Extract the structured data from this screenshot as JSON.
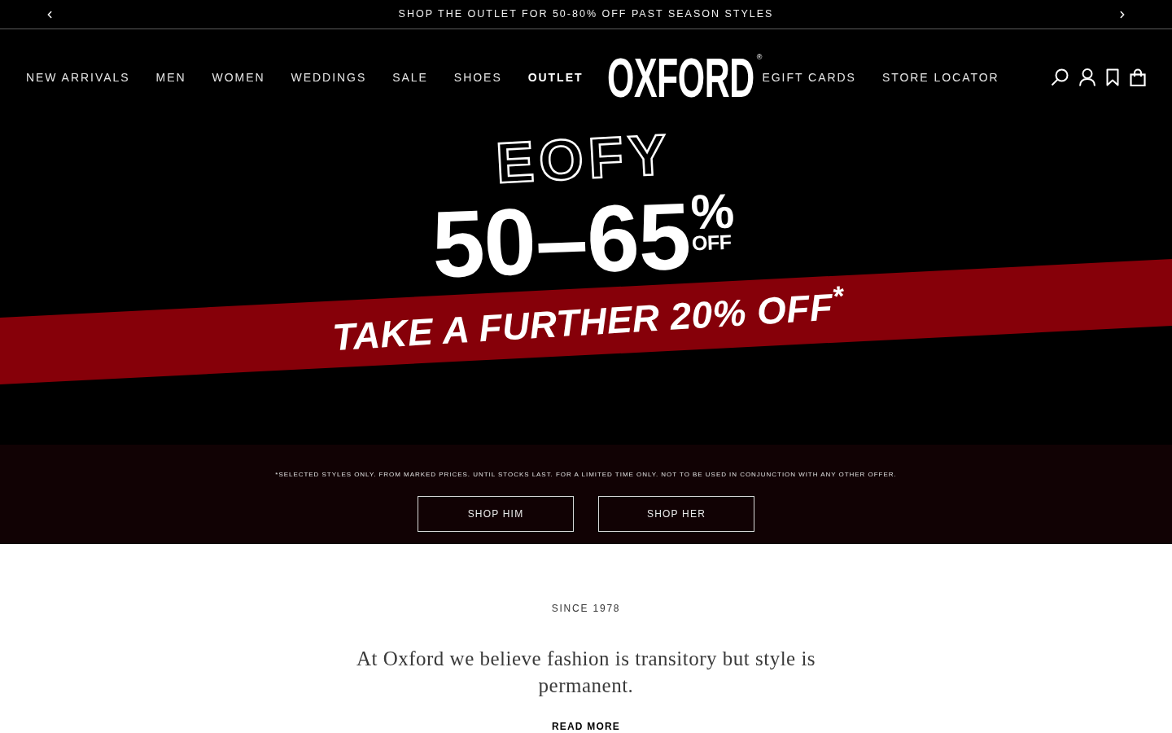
{
  "announcement_bar": {
    "message": "SHOP THE OUTLET FOR 50-80% OFF PAST SEASON STYLES"
  },
  "header": {
    "nav_left": [
      {
        "label": "NEW ARRIVALS",
        "emphasized": false
      },
      {
        "label": "MEN",
        "emphasized": false
      },
      {
        "label": "WOMEN",
        "emphasized": false
      },
      {
        "label": "WEDDINGS",
        "emphasized": false
      },
      {
        "label": "SALE",
        "emphasized": false
      },
      {
        "label": "SHOES",
        "emphasized": false
      },
      {
        "label": "OUTLET",
        "emphasized": true
      }
    ],
    "logo": {
      "text": "OXFORD",
      "mark": "®"
    },
    "nav_right": [
      {
        "label": "EGIFT CARDS",
        "emphasized": false
      },
      {
        "label": "STORE LOCATOR",
        "emphasized": false
      }
    ]
  },
  "hero": {
    "kicker": "EOFY",
    "discount": "50–65",
    "percent": "%",
    "off": "OFF",
    "band_text": "TAKE A FURTHER 20% OFF$^{*}$"
  },
  "promo": {
    "disclaimer": "*SELECTED STYLES ONLY. FROM MARKED PRICES. UNTIL STOCKS LAST. FOR A LIMITED TIME ONLY. NOT TO BE USED IN CONJUNCTION WITH ANY OTHER OFFER.",
    "buttons": [
      "SHOP HIM",
      "SHOP HER"
    ]
  },
  "about": {
    "eyebrow": "SINCE 1978",
    "quote": "At Oxford we believe fashion is transitory but style is permanent.",
    "link": "READ MORE"
  }
}
